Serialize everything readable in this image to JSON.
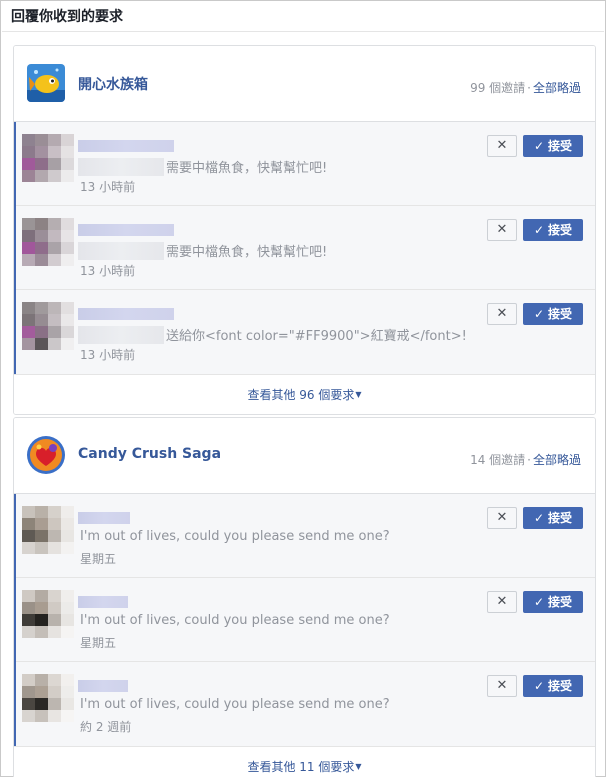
{
  "page": {
    "title": "回覆你收到的要求"
  },
  "ui": {
    "decline_glyph": "✕",
    "accept_check": "✓",
    "separator": "·",
    "caret": "▼"
  },
  "groups": [
    {
      "app_name": "開心水族箱",
      "invites": "99 個邀請",
      "ignore_all": "全部略過",
      "accept_label": "接受",
      "requests": [
        {
          "message": "需要中檔魚食，快幫幫忙吧!",
          "time": "13 小時前"
        },
        {
          "message": "需要中檔魚食，快幫幫忙吧!",
          "time": "13 小時前"
        },
        {
          "message": "送給你<font color=\"#FF9900\">紅寶戒</font>!",
          "time": "13 小時前"
        }
      ],
      "see_more": "查看其他 96 個要求"
    },
    {
      "app_name": "Candy Crush Saga",
      "invites": "14 個邀請",
      "ignore_all": "全部略過",
      "accept_label": "接受",
      "requests": [
        {
          "message": "I'm out of lives, could you please send me one?",
          "time": "星期五"
        },
        {
          "message": "I'm out of lives, could you please send me one?",
          "time": "星期五"
        },
        {
          "message": "I'm out of lives, could you please send me one?",
          "time": "約 2 週前"
        }
      ],
      "see_more": "查看其他 11 個要求"
    }
  ],
  "icons": {
    "aquarium_app": "fish-app-icon",
    "candy_app": "candy-app-icon"
  },
  "colors": {
    "accent": "#4267b2",
    "link": "#365899",
    "muted": "#90949c"
  }
}
